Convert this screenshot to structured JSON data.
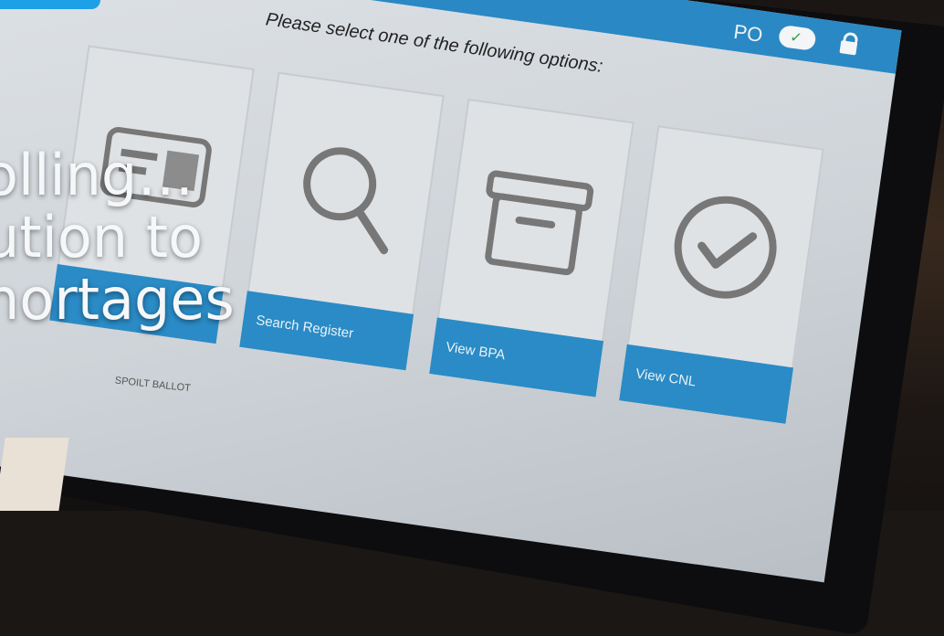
{
  "top_bar": {
    "initials": "PO"
  },
  "prompt": "Please select one of the following options:",
  "options": [
    {
      "label": "Search Register",
      "icon": "magnifier-icon"
    },
    {
      "label": "View BPA",
      "icon": "archive-box-icon"
    },
    {
      "label": "View CNL",
      "icon": "check-circle-icon"
    }
  ],
  "footer_label": "SPOILT BALLOT",
  "overlay_headline": [
    "olling…",
    "ution to",
    "hortages"
  ],
  "colors": {
    "accent": "#2a8bc6",
    "headline": "#f5f7f9"
  }
}
